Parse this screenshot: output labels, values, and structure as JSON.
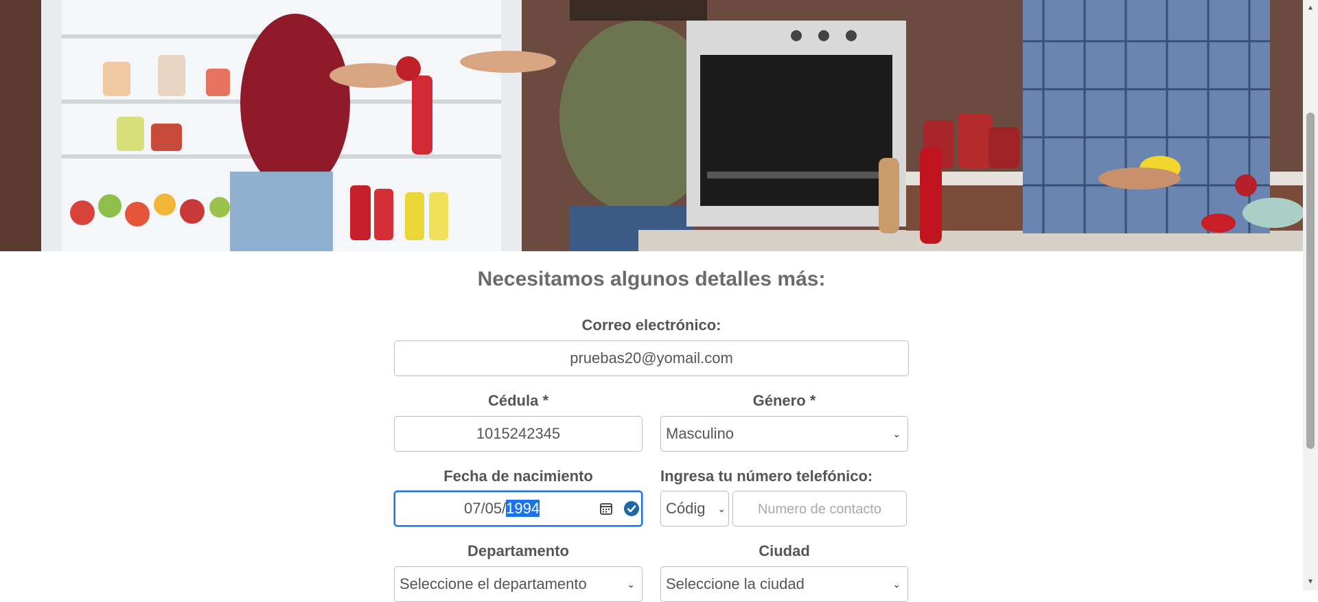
{
  "form": {
    "title": "Necesitamos algunos detalles más:",
    "email": {
      "label": "Correo electrónico:",
      "value": "pruebas20@yomail.com"
    },
    "cedula": {
      "label": "Cédula *",
      "value": "1015242345"
    },
    "genero": {
      "label": "Género *",
      "value": "Masculino"
    },
    "fecha": {
      "label": "Fecha de nacimiento",
      "value_prefix": "07/05/",
      "value_selected": "1994"
    },
    "telefono": {
      "label": "Ingresa tu número telefónico:",
      "code_value": "Códig",
      "placeholder": "Numero de contacto"
    },
    "departamento": {
      "label": "Departamento",
      "value": "Seleccione el departamento"
    },
    "ciudad": {
      "label": "Ciudad",
      "value": "Seleccione la ciudad"
    }
  },
  "icons": {
    "calendar": "calendar-icon",
    "check": "check-circle-icon",
    "chevron": "chevron-down-icon"
  },
  "colors": {
    "focus_border": "#1a73e8",
    "text": "#555555",
    "title": "#6b6b6b"
  }
}
